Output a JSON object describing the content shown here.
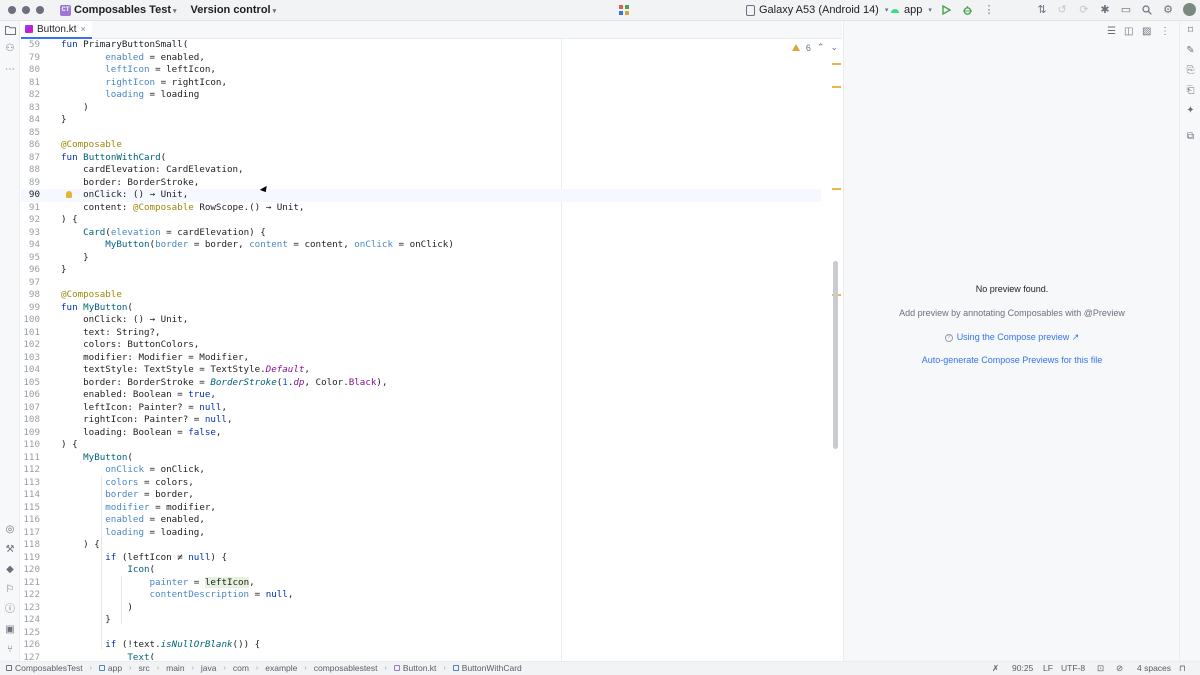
{
  "titlebar": {
    "project_badge": "CT",
    "project_name": "Composables Test",
    "version_control": "Version control",
    "device": "Galaxy A53 (Android 14)",
    "run_config": "app"
  },
  "tab": {
    "label": "Button.kt",
    "close": "×"
  },
  "inspections": {
    "warning_count": "6"
  },
  "code_lines": [
    {
      "n": "59",
      "html": "<span class=\"kw\">fun</span> PrimaryButtonSmall("
    },
    {
      "n": "79",
      "html": "        <span class=\"param\">enabled</span> = enabled,"
    },
    {
      "n": "80",
      "html": "        <span class=\"param\">leftIcon</span> = leftIcon,"
    },
    {
      "n": "81",
      "html": "        <span class=\"param\">rightIcon</span> = rightIcon,"
    },
    {
      "n": "82",
      "html": "        <span class=\"param\">loading</span> = loading"
    },
    {
      "n": "83",
      "html": "    )"
    },
    {
      "n": "84",
      "html": "}"
    },
    {
      "n": "85",
      "html": ""
    },
    {
      "n": "86",
      "html": "<span class=\"ann\">@Composable</span>"
    },
    {
      "n": "87",
      "html": "<span class=\"kw\">fun</span> <span class=\"fn\">ButtonWithCard</span>("
    },
    {
      "n": "88",
      "html": "    cardElevation: CardElevation,"
    },
    {
      "n": "89",
      "html": "    border: BorderStroke,"
    },
    {
      "n": "90",
      "html": "    onClick: () → Unit,",
      "current": true
    },
    {
      "n": "91",
      "html": "    content: <span class=\"ann\">@Composable</span> RowScope.() → Unit,"
    },
    {
      "n": "92",
      "html": ") {"
    },
    {
      "n": "93",
      "html": "    <span class=\"fn\">Card</span>(<span class=\"param\">elevation</span> = cardElevation) {"
    },
    {
      "n": "94",
      "html": "        <span class=\"fn\">MyButton</span>(<span class=\"param\">border</span> = border, <span class=\"param\">content</span> = content, <span class=\"param\">onClick</span> = onClick)"
    },
    {
      "n": "95",
      "html": "    }"
    },
    {
      "n": "96",
      "html": "}"
    },
    {
      "n": "97",
      "html": ""
    },
    {
      "n": "98",
      "html": "<span class=\"ann\">@Composable</span>"
    },
    {
      "n": "99",
      "html": "<span class=\"kw\">fun</span> <span class=\"fn\">MyButton</span>("
    },
    {
      "n": "100",
      "html": "    onClick: () → Unit,"
    },
    {
      "n": "101",
      "html": "    text: String?,"
    },
    {
      "n": "102",
      "html": "    colors: ButtonColors,"
    },
    {
      "n": "103",
      "html": "    modifier: Modifier = Modifier,"
    },
    {
      "n": "104",
      "html": "    textStyle: TextStyle = TextStyle.<span class=\"prop it\">Default</span>,"
    },
    {
      "n": "105",
      "html": "    border: BorderStroke = <span class=\"fn it\">BorderStroke</span>(<span class=\"num\">1</span>.<span class=\"prop it\">dp</span>, Color.<span class=\"prop\">Black</span>),"
    },
    {
      "n": "106",
      "html": "    enabled: Boolean = <span class=\"kw\">true</span>,"
    },
    {
      "n": "107",
      "html": "    leftIcon: Painter? = <span class=\"kw\">null</span>,"
    },
    {
      "n": "108",
      "html": "    rightIcon: Painter? = <span class=\"kw\">null</span>,"
    },
    {
      "n": "109",
      "html": "    loading: Boolean = <span class=\"kw\">false</span>,"
    },
    {
      "n": "110",
      "html": ") {"
    },
    {
      "n": "111",
      "html": "    <span class=\"fn\">MyButton</span>("
    },
    {
      "n": "112",
      "html": "        <span class=\"param\">onClick</span> = onClick,"
    },
    {
      "n": "113",
      "html": "        <span class=\"param\">colors</span> = colors,"
    },
    {
      "n": "114",
      "html": "        <span class=\"param\">border</span> = border,"
    },
    {
      "n": "115",
      "html": "        <span class=\"param\">modifier</span> = modifier,"
    },
    {
      "n": "116",
      "html": "        <span class=\"param\">enabled</span> = enabled,"
    },
    {
      "n": "117",
      "html": "        <span class=\"param\">loading</span> = loading,"
    },
    {
      "n": "118",
      "html": "    ) {"
    },
    {
      "n": "119",
      "html": "        <span class=\"kw\">if</span> (leftIcon ≠ <span class=\"kw\">null</span>) {"
    },
    {
      "n": "120",
      "html": "            <span class=\"fn\">Icon</span>("
    },
    {
      "n": "121",
      "html": "                <span class=\"param\">painter</span> = <span class=\"hl\">leftIcon</span>,"
    },
    {
      "n": "122",
      "html": "                <span class=\"param\">contentDescription</span> = <span class=\"kw\">null</span>,"
    },
    {
      "n": "123",
      "html": "            )"
    },
    {
      "n": "124",
      "html": "        }"
    },
    {
      "n": "125",
      "html": ""
    },
    {
      "n": "126",
      "html": "        <span class=\"kw\">if</span> (!text.<span class=\"fn it\">isNullOrBlank</span>()) {"
    },
    {
      "n": "127",
      "html": "            <span class=\"fn\">Text</span>("
    }
  ],
  "preview": {
    "no_preview": "No preview found.",
    "hint": "Add preview by annotating Composables with @Preview",
    "help_link": "Using the Compose preview ↗",
    "autogen_link": "Auto-generate Compose Previews for this file"
  },
  "breadcrumbs": [
    "ComposablesTest",
    "app",
    "src",
    "main",
    "java",
    "com",
    "example",
    "composablestest",
    "Button.kt",
    "ButtonWithCard"
  ],
  "status": {
    "position": "90:25",
    "line_sep": "LF",
    "encoding": "UTF-8",
    "indent": "4 spaces"
  },
  "colors": {
    "accent": "#3574f0",
    "keyword": "#0033b3",
    "annotation": "#9e880d",
    "named_arg": "#4a86c7",
    "warning": "#e0a33a"
  }
}
